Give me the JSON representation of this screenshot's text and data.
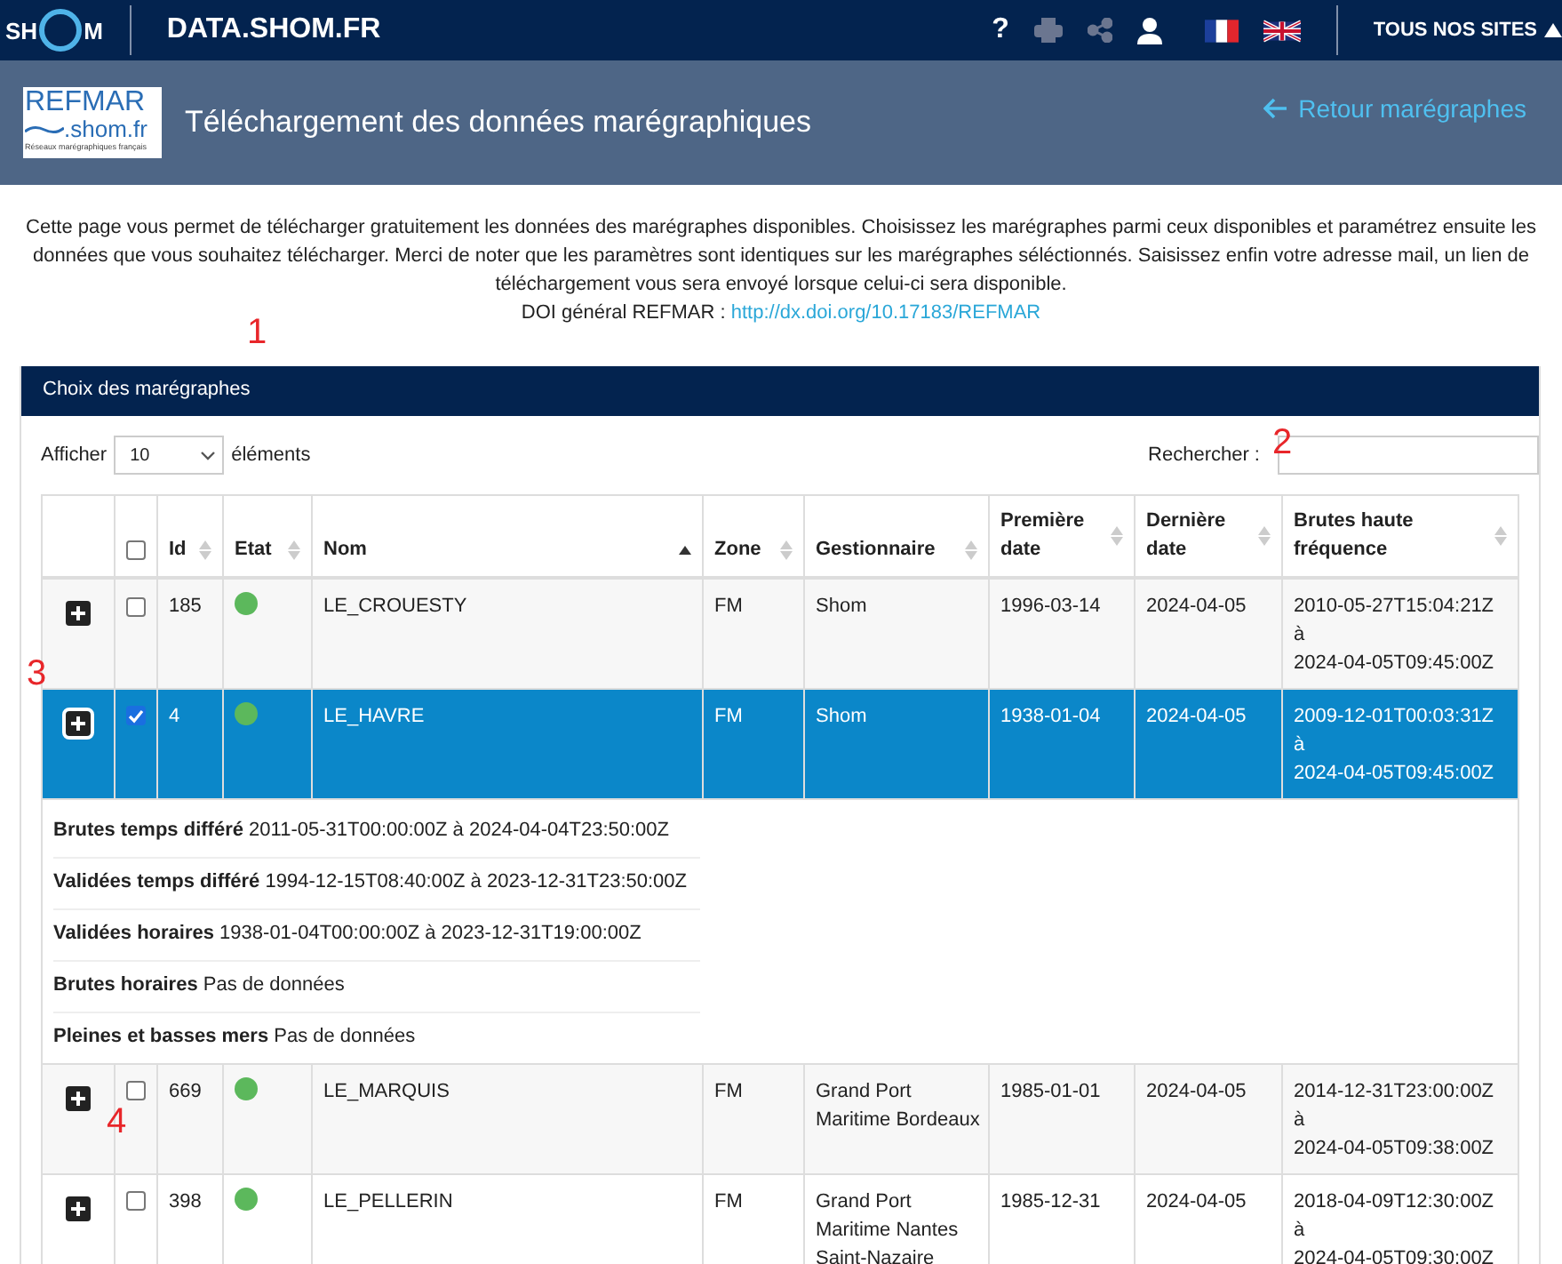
{
  "topbar": {
    "logo_left": "SH",
    "logo_right": "M",
    "site": "DATA.SHOM.FR",
    "help": "?",
    "all_sites": "TOUS NOS SITES"
  },
  "banner": {
    "logo_top": "REFMAR",
    "logo_mid": ".shom.fr",
    "logo_sub": "Réseaux marégraphiques français",
    "title": "Téléchargement des données marégraphiques",
    "back_link": "Retour marégraphes"
  },
  "intro": {
    "text": "Cette page vous permet de télécharger gratuitement les données des marégraphes disponibles. Choisissez les marégraphes parmi ceux disponibles et paramétrez ensuite les données que vous souhaitez télécharger. Merci de noter que les paramètres sont identiques sur les marégraphes séléctionnés. Saisissez enfin votre adresse mail, un lien de téléchargement vous sera envoyé lorsque celui-ci sera disponible.",
    "doi_label": "DOI général REFMAR :",
    "doi_link": "http://dx.doi.org/10.17183/REFMAR"
  },
  "panel": {
    "title": "Choix des marégraphes",
    "show_label": "Afficher",
    "page_size": "10",
    "show_suffix": "éléments",
    "search_label": "Rechercher :"
  },
  "table": {
    "select_all_checked": false,
    "columns": [
      {
        "label": "Id",
        "sorted": false
      },
      {
        "label": "Etat",
        "sorted": false
      },
      {
        "label": "Nom",
        "sorted": true
      },
      {
        "label": "Zone",
        "sorted": false
      },
      {
        "label": "Gestionnaire",
        "sorted": false
      },
      {
        "label": "Première date",
        "sorted": false
      },
      {
        "label": "Dernière date",
        "sorted": false
      },
      {
        "label": "Brutes haute fréquence",
        "sorted": false
      }
    ],
    "rows": [
      {
        "id": "185",
        "color": "#5cb85c",
        "name": "LE_CROUESTY",
        "zone": "FM",
        "manager": "Shom",
        "first": "1996-03-14",
        "last": "2024-04-05",
        "hf_from": "2010-05-27T15:04:21Z",
        "hf_to_word": "à",
        "hf_to": "2024-04-05T09:45:00Z",
        "checked": false,
        "selected": false
      },
      {
        "id": "4",
        "color": "#5cb85c",
        "name": "LE_HAVRE",
        "zone": "FM",
        "manager": "Shom",
        "first": "1938-01-04",
        "last": "2024-04-05",
        "hf_from": "2009-12-01T00:03:31Z",
        "hf_to_word": "à",
        "hf_to": "2024-04-05T09:45:00Z",
        "checked": true,
        "selected": true,
        "details": [
          "**Brutes temps différé** 2011-05-31T00:00:00Z à 2024-04-04T23:50:00Z",
          "**Validées temps différé** 1994-12-15T08:40:00Z à 2023-12-31T23:50:00Z",
          "**Validées horaires** 1938-01-04T00:00:00Z à 2023-12-31T19:00:00Z",
          "**Brutes horaires** Pas de données",
          "**Pleines et basses mers** Pas de données"
        ]
      },
      {
        "id": "669",
        "color": "#5cb85c",
        "name": "LE_MARQUIS",
        "zone": "FM",
        "manager": "Grand Port Maritime Bordeaux",
        "first": "1985-01-01",
        "last": "2024-04-05",
        "hf_from": "2014-12-31T23:00:00Z",
        "hf_to_word": "à",
        "hf_to": "2024-04-05T09:38:00Z",
        "checked": false,
        "selected": false
      },
      {
        "id": "398",
        "color": "#5cb85c",
        "name": "LE_PELLERIN",
        "zone": "FM",
        "manager": "Grand Port Maritime Nantes Saint-Nazaire",
        "first": "1985-12-31",
        "last": "2024-04-05",
        "hf_from": "2018-04-09T12:30:00Z",
        "hf_to_word": "à",
        "hf_to": "2024-04-05T09:30:00Z",
        "checked": false,
        "selected": false
      }
    ]
  },
  "annotations": [
    "1",
    "2",
    "3",
    "4"
  ]
}
